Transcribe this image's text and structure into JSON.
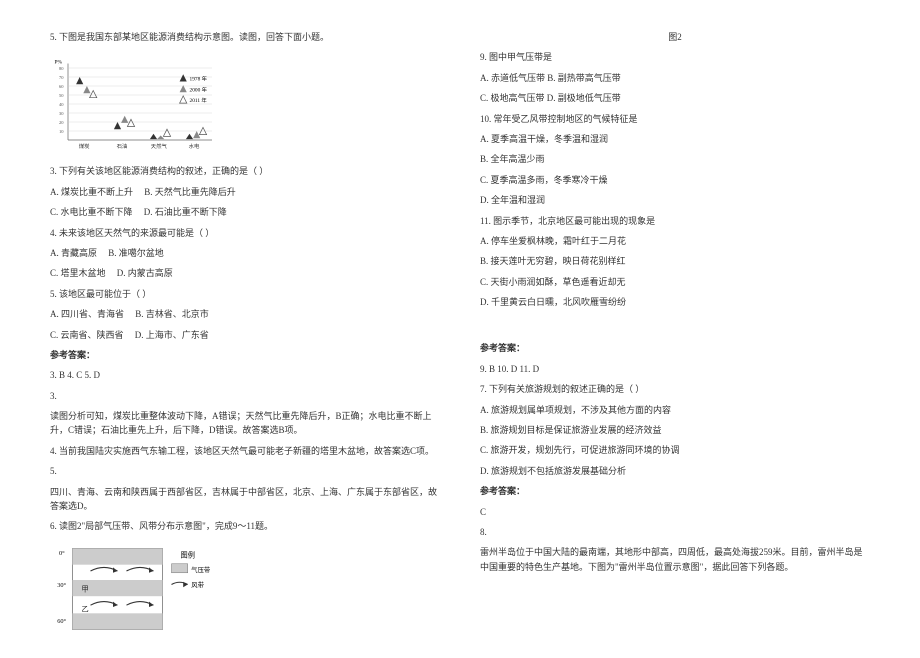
{
  "left": {
    "q5_intro": "5. 下图是我国东部某地区能源消费结构示意图。读图，回答下面小题。",
    "chart1_legend": [
      "1978 年",
      "2000 年",
      "2011 年"
    ],
    "chart1_x": [
      "煤炭",
      "石油",
      "天然气",
      "水电"
    ],
    "chart1_ymax": 80,
    "q3": "3. 下列有关该地区能源消费结构的叙述，正确的是（   ）",
    "q3a": "A. 煤炭比重不断上升",
    "q3b": "B. 天然气比重先降后升",
    "q3c": "C. 水电比重不断下降",
    "q3d": "D. 石油比重不断下降",
    "q4": "4. 未来该地区天然气的来源最可能是（   ）",
    "q4a": "A. 青藏高原",
    "q4b": "B. 准噶尔盆地",
    "q4c": "C. 塔里木盆地",
    "q4d": "D. 内蒙古高原",
    "q5": "5. 该地区最可能位于（   ）",
    "q5a": "A. 四川省、青海省",
    "q5b": "B. 吉林省、北京市",
    "q5c": "C. 云南省、陕西省",
    "q5d": "D. 上海市、广东省",
    "ref": "参考答案：",
    "ans1": "3. B    4. C    5. D",
    "ans_num": "3.",
    "exp1": "读图分析可知，煤炭比重整体波动下降，A错误；天然气比重先降后升，B正确；水电比重不断上升，C错误；石油比重先上升，后下降，D错误。故答案选B项。",
    "exp2": "4. 当前我国陆灾实施西气东输工程，该地区天然气最可能老子新疆的塔里木盆地，故答案选C项。",
    "exp3_num": "5.",
    "exp3": "四川、青海、云南和陕西属于西部省区，吉林属于中部省区，北京、上海、广东属于东部省区，故答案选D。",
    "q6": "6. 读图2\"局部气压带、风带分布示意图\"，完成9～11题。",
    "chart2_legend_label1": "图例",
    "chart2_legend_item1": "气压带",
    "chart2_legend_item2": "风带",
    "chart2_ticks": [
      "0°",
      "30°",
      "60°"
    ]
  },
  "right": {
    "fig2": "图2",
    "q9": "9. 图中甲气压带是",
    "q9a": "A. 赤道低气压带 B. 副热带高气压带",
    "q9b": "C. 极地高气压带 D. 副极地低气压带",
    "q10": "10. 常年受乙风带控制地区的气候特征是",
    "q10a": "A. 夏季高温干燥，冬季温和湿润",
    "q10b": "B. 全年高温少雨",
    "q10c": "C. 夏季高温多雨，冬季寒冷干燥",
    "q10d": "D. 全年温和湿润",
    "q11": "11. 图示季节，北京地区最可能出现的现象是",
    "q11a": "A. 停车坐爱枫林晚，霜叶红于二月花",
    "q11b": "B. 接天莲叶无穷碧，映日荷花别样红",
    "q11c": "C. 天街小雨润如酥，草色遥看近却无",
    "q11d": "D. 千里黄云白日曛，北风吹雁雪纷纷",
    "ref2": "参考答案：",
    "ans2": "9. B    10. D  11. D",
    "q7": "7. 下列有关旅游规划的叙述正确的是（    ）",
    "q7a": "A. 旅游规划属单项规划，不涉及其他方面的内容",
    "q7b": "B. 旅游规划目标是保证旅游业发展的经济效益",
    "q7c": "C. 旅游开发，规划先行，可促进旅游同环境的协调",
    "q7d": "D. 旅游规划不包括旅游发展基础分析",
    "ref3": "参考答案：",
    "ans3": "C",
    "q8num": "8.",
    "q8text": "雷州半岛位于中国大陆的最南端，其地形中部高，四周低，最高处海拔259米。目前，雷州半岛是中国重要的特色生产基地。下图为\"雷州半岛位置示意图\"，据此回答下列各题。"
  },
  "chart_data": [
    {
      "type": "bar",
      "title": "能源消费结构",
      "categories": [
        "煤炭",
        "石油",
        "天然气",
        "水电"
      ],
      "series": [
        {
          "name": "1978 年",
          "values": [
            70,
            20,
            5,
            5
          ]
        },
        {
          "name": "2000 年",
          "values": [
            60,
            25,
            3,
            8
          ]
        },
        {
          "name": "2011 年",
          "values": [
            55,
            22,
            10,
            12
          ]
        }
      ],
      "ylabel": "P%",
      "ylim": [
        0,
        80
      ]
    },
    {
      "type": "diagram",
      "title": "局部气压带、风带分布示意图",
      "bands": [
        {
          "lat": "0° - 30°",
          "label": "甲",
          "type": "气压带"
        },
        {
          "lat": "30° - 60°",
          "label": "乙",
          "type": "风带"
        }
      ],
      "legend": [
        "气压带",
        "风带"
      ]
    }
  ]
}
